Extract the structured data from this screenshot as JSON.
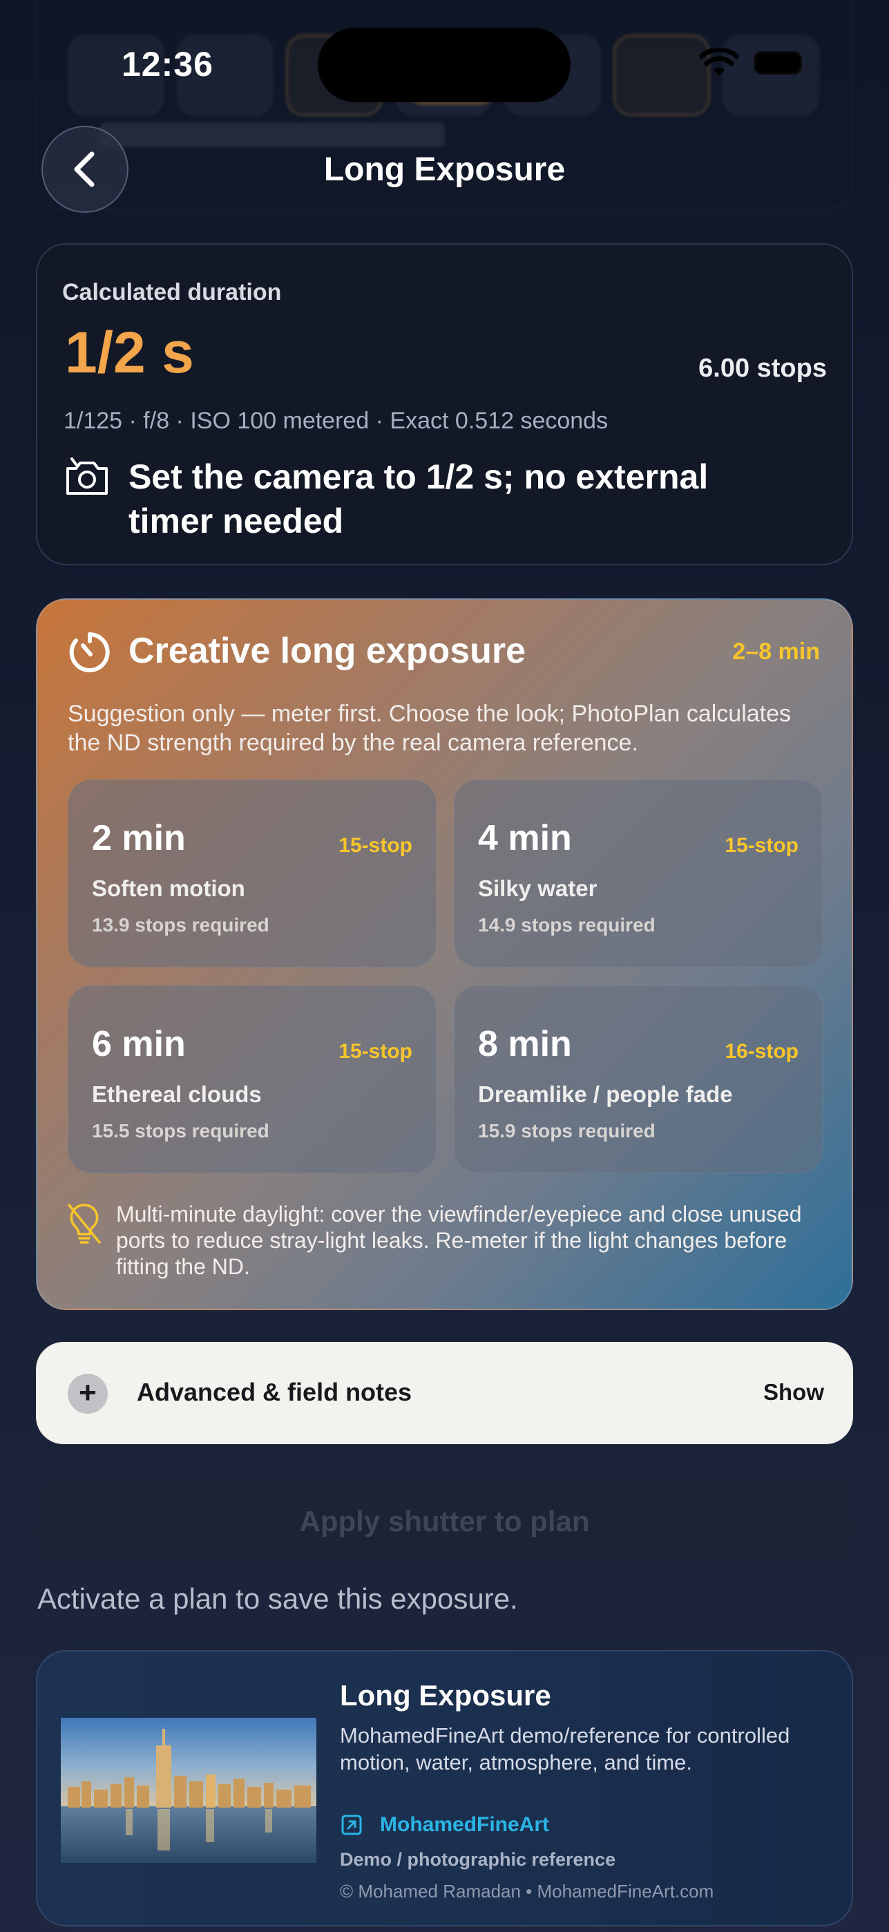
{
  "status_bar": {
    "time": "12:36"
  },
  "header": {
    "title": "Long Exposure"
  },
  "duration_card": {
    "label": "Calculated duration",
    "value": "1/2 s",
    "stops": "6.00 stops",
    "meta": "1/125 · f/8 · ISO 100 metered · Exact 0.512 seconds",
    "note": "Set the camera to 1/2 s; no external timer needed"
  },
  "creative": {
    "title": "Creative long exposure",
    "range": "2–8 min",
    "suggestion": "Suggestion only — meter first. Choose the look; PhotoPlan calculates the ND strength required by the real camera reference.",
    "options": [
      {
        "time": "2 min",
        "nd": "15-stop",
        "desc": "Soften motion",
        "stops": "13.9 stops required"
      },
      {
        "time": "4 min",
        "nd": "15-stop",
        "desc": "Silky water",
        "stops": "14.9 stops required"
      },
      {
        "time": "6 min",
        "nd": "15-stop",
        "desc": "Ethereal clouds",
        "stops": "15.5 stops required"
      },
      {
        "time": "8 min",
        "nd": "16-stop",
        "desc": "Dreamlike / people fade",
        "stops": "15.9 stops required"
      }
    ],
    "warning": "Multi-minute daylight: cover the viewfinder/eyepiece and close unused ports to reduce stray-light leaks. Re-meter if the light changes before fitting the ND."
  },
  "advanced": {
    "label": "Advanced & field notes",
    "action": "Show"
  },
  "apply": {
    "label": "Apply shutter to plan",
    "hint": "Activate a plan to save this exposure."
  },
  "reference": {
    "title": "Long Exposure",
    "description": "MohamedFineArt demo/reference for controlled motion, water, atmosphere, and time.",
    "link": "MohamedFineArt",
    "type": "Demo / photographic reference",
    "copyright": "© Mohamed Ramadan • MohamedFineArt.com"
  },
  "colors": {
    "accent": "#f2a54a",
    "nd_badge": "#f8c52a",
    "link": "#2ab5e6"
  },
  "icons": [
    "chevron-left-icon",
    "camera-icon",
    "timer-icon",
    "lightbulb-icon",
    "plus-icon",
    "external-link-icon",
    "wifi-icon",
    "battery-icon"
  ]
}
